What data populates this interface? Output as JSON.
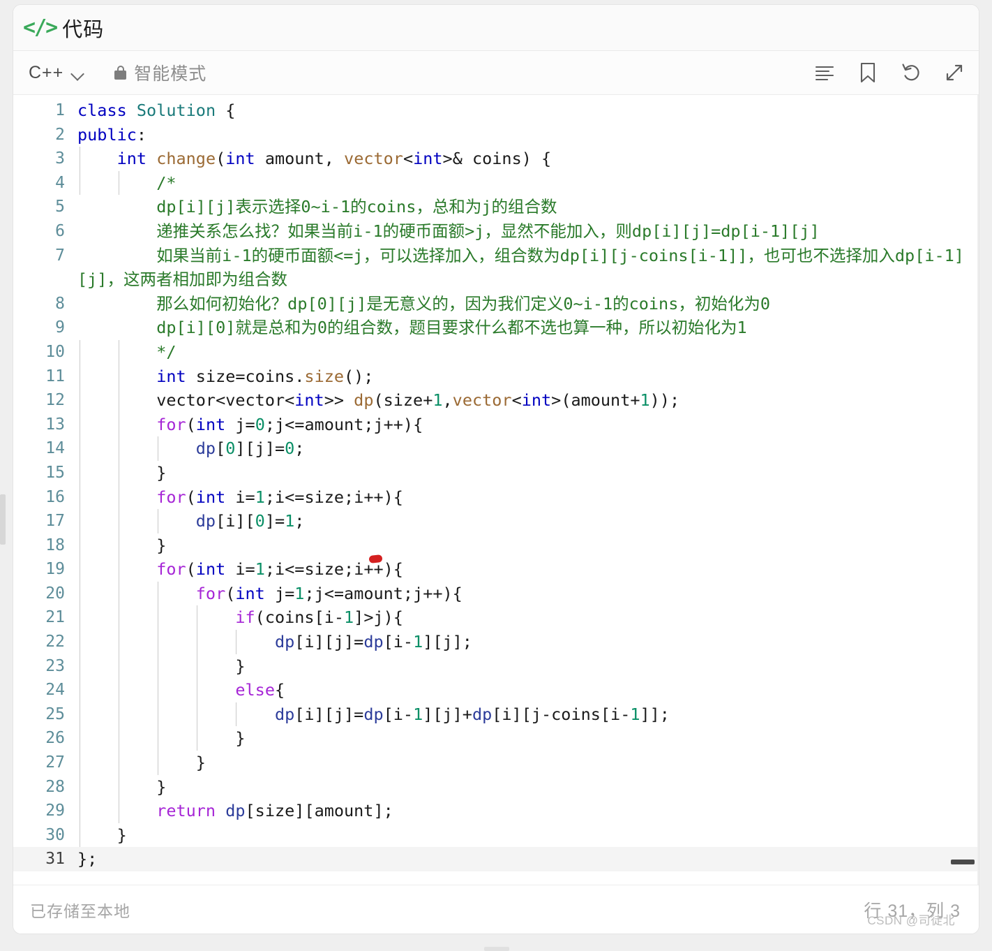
{
  "window": {
    "title": "代码",
    "title_icon": "code-brackets-icon",
    "accent_green": "#3aa95a"
  },
  "toolbar": {
    "language": "C++",
    "language_chevron_icon": "chevron-down-icon",
    "lock_icon": "lock-icon",
    "mode_label": "智能模式",
    "icons": [
      {
        "name": "format-lines-icon"
      },
      {
        "name": "bookmark-icon"
      },
      {
        "name": "undo-reset-icon"
      },
      {
        "name": "fullscreen-expand-icon"
      }
    ]
  },
  "editor": {
    "language": "cpp",
    "active_line": 31,
    "lines": [
      {
        "n": 1,
        "text": "class Solution {"
      },
      {
        "n": 2,
        "text": "public:"
      },
      {
        "n": 3,
        "text": "    int change(int amount, vector<int>& coins) {"
      },
      {
        "n": 4,
        "text": "        /*"
      },
      {
        "n": 5,
        "text": "        dp[i][j]表示选择0~i-1的coins，总和为j的组合数"
      },
      {
        "n": 6,
        "text": "        递推关系怎么找？如果当前i-1的硬币面额>j，显然不能加入，则dp[i][j]=dp[i-1][j]"
      },
      {
        "n": 7,
        "text": "        如果当前i-1的硬币面额<=j，可以选择加入，组合数为dp[i][j-coins[i-1]]，也可也不选择加入dp[i-1][j]，这两者相加即为组合数"
      },
      {
        "n": 8,
        "text": "        那么如何初始化？dp[0][j]是无意义的，因为我们定义0~i-1的coins，初始化为0"
      },
      {
        "n": 9,
        "text": "        dp[i][0]就是总和为0的组合数，题目要求什么都不选也算一种，所以初始化为1"
      },
      {
        "n": 10,
        "text": "        */"
      },
      {
        "n": 11,
        "text": "        int size=coins.size();"
      },
      {
        "n": 12,
        "text": "        vector<vector<int>> dp(size+1,vector<int>(amount+1));"
      },
      {
        "n": 13,
        "text": "        for(int j=0;j<=amount;j++){"
      },
      {
        "n": 14,
        "text": "            dp[0][j]=0;"
      },
      {
        "n": 15,
        "text": "        }"
      },
      {
        "n": 16,
        "text": "        for(int i=1;i<=size;i++){"
      },
      {
        "n": 17,
        "text": "            dp[i][0]=1;"
      },
      {
        "n": 18,
        "text": "        }"
      },
      {
        "n": 19,
        "text": "        for(int i=1;i<=size;i++){"
      },
      {
        "n": 20,
        "text": "            for(int j=1;j<=amount;j++){"
      },
      {
        "n": 21,
        "text": "                if(coins[i-1]>j){"
      },
      {
        "n": 22,
        "text": "                    dp[i][j]=dp[i-1][j];"
      },
      {
        "n": 23,
        "text": "                }"
      },
      {
        "n": 24,
        "text": "                else{"
      },
      {
        "n": 25,
        "text": "                    dp[i][j]=dp[i-1][j]+dp[i][j-coins[i-1]];"
      },
      {
        "n": 26,
        "text": "                }"
      },
      {
        "n": 27,
        "text": "            }"
      },
      {
        "n": 28,
        "text": "        }"
      },
      {
        "n": 29,
        "text": "        return dp[size][amount];"
      },
      {
        "n": 30,
        "text": "    }"
      },
      {
        "n": 31,
        "text": "};"
      }
    ],
    "annotation_mark": "red-dot"
  },
  "footer": {
    "status": "已存储至本地",
    "cursor": "行 31，列 3",
    "watermark": "CSDN @司徒北"
  }
}
